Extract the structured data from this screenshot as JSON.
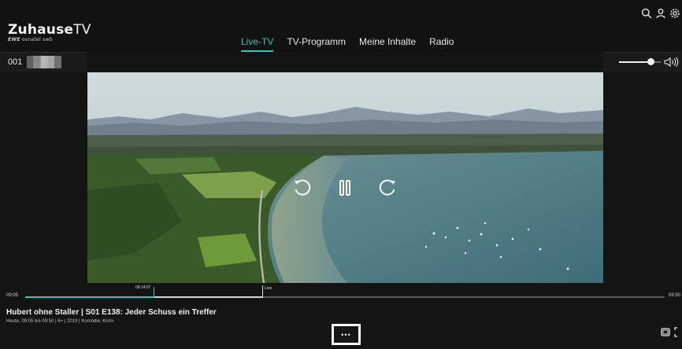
{
  "app": {
    "logo_text": "ZuhauseTV",
    "logo_sub": "EWE osnatel swb"
  },
  "nav": {
    "items": [
      {
        "label": "Live-TV",
        "active": true
      },
      {
        "label": "TV-Programm",
        "active": false
      },
      {
        "label": "Meine Inhalte",
        "active": false
      },
      {
        "label": "Radio",
        "active": false
      }
    ]
  },
  "top_icons": [
    "search-icon",
    "user-icon",
    "gear-icon"
  ],
  "channel": {
    "number": "001"
  },
  "volume": {
    "level": 0.85
  },
  "player": {
    "controls": [
      "rewind-icon",
      "pause-icon",
      "forward-icon"
    ]
  },
  "timeline": {
    "start": "09:05",
    "end": "09:50",
    "current": "09:14:07",
    "live_label": "Live"
  },
  "program": {
    "title": "Hubert ohne Staller | S01 E138: Jeder Schuss ein Treffer",
    "meta": "Heute, 09:05 bis 09:50 | 6+ | 2019 | Komödie, Krimi",
    "more_label": "•••"
  },
  "colors": {
    "accent": "#3cc3b4",
    "background": "#141414"
  }
}
